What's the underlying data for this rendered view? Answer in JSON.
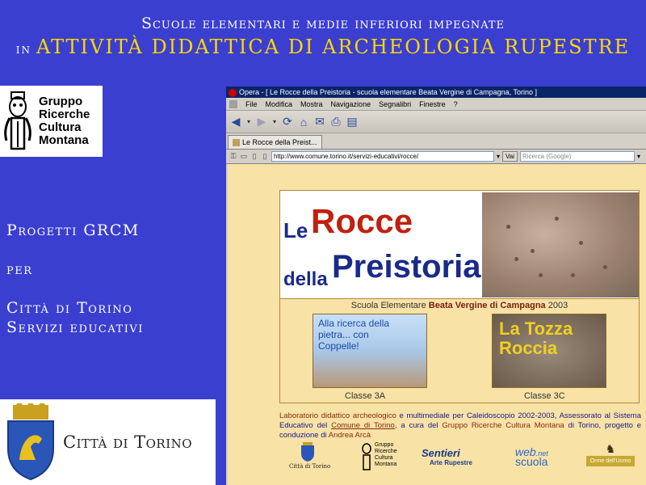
{
  "slide": {
    "title_line1": "Scuole elementari e medie inferiori impegnate",
    "title_in": "in",
    "title_line2": "ATTIVITÀ DIDATTICA DI ARCHEOLOGIA RUPESTRE",
    "left_progetti": "Progetti GRCM",
    "left_per": "per",
    "left_citta": "Città di Torino",
    "left_servizi": "Servizi educativi",
    "grcm_logo_lines": [
      "Gruppo",
      "Ricerche",
      "Cultura",
      "Montana"
    ],
    "citta_logo_text": "Città di Torino"
  },
  "browser": {
    "window_title": "Opera - [ Le Rocce della Preistoria - scuola elementare Beata Vergine di Campagna, Torino ]",
    "menu": [
      "File",
      "Modifica",
      "Mostra",
      "Navigazione",
      "Segnalibri",
      "Finestre",
      "?"
    ],
    "toolbar_icons": [
      "back-icon",
      "dropdown-icon",
      "forward-icon",
      "dropdown-icon",
      "reload-icon",
      "home-icon",
      "hotlist-icon",
      "print-icon",
      "page-icon"
    ],
    "tab_label": "Le Rocce della Preist...",
    "address": "http://www.comune.torino.it/servizi-educativi/rocce/",
    "go_label": "Vai",
    "search_placeholder": "Ricerca (Google)"
  },
  "page": {
    "hero_le": "Le",
    "hero_rocce": "Rocce",
    "hero_della": "della",
    "hero_preistoria": "Preistoria",
    "subtitle_pre": "Scuola Elementare",
    "subtitle_bold": "Beata Vergine di Campagna",
    "subtitle_year": "2003",
    "thumb_a_text": "Alla ricerca della pietra... con Coppelle!",
    "thumb_c_text": "La Tozza Roccia",
    "class_a": "Classe 3A",
    "class_c": "Classe 3C",
    "para_1": "Laboratorio didattico archeologico",
    "para_2": " e multimediale per Caleidoscopio 2002-2003, Assessorato al Sistema Educativo del ",
    "para_link1": "Comune di Torino",
    "para_3": ", a cura del ",
    "para_link2": "Gruppo Ricerche Cultura Montana",
    "para_4": " di Torino, progetto e conduzione di ",
    "para_link3": "Andrea Arcà",
    "logo1": "Città di Torino",
    "logo2_lines": [
      "Gruppo",
      "Ricerche",
      "Cultura",
      "Montana"
    ],
    "logo3_a": "Sentieri",
    "logo3_b": "Arte Rupestre",
    "logo4_a": "web",
    "logo4_b": ".net",
    "logo4_c": "scuola",
    "logo5": "Orme dell'Uomo"
  }
}
